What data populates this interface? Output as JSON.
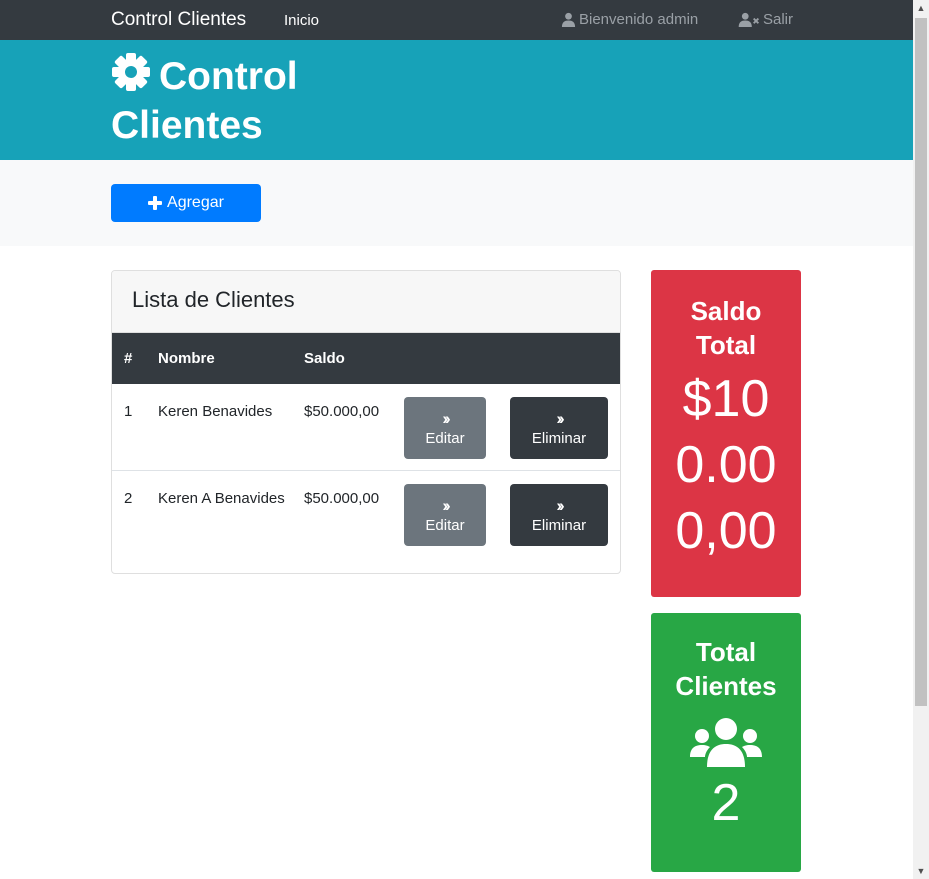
{
  "navbar": {
    "brand": "Control Clientes",
    "inicio": "Inicio",
    "welcome": "Bienvenido admin",
    "logout": "Salir",
    "icons": {
      "welcome": "user-icon",
      "logout": "user-times-icon"
    }
  },
  "header": {
    "title": "Control Clientes",
    "icon": "gear-icon"
  },
  "actions": {
    "add_label": "Agregar",
    "add_icon": "plus-icon"
  },
  "clients_card": {
    "title": "Lista de Clientes",
    "columns": [
      "#",
      "Nombre",
      "Saldo"
    ],
    "rows": [
      {
        "num": "1",
        "name": "Keren Benavides",
        "saldo": "$50.000,00",
        "edit_label": "Editar",
        "delete_label": "Eliminar"
      },
      {
        "num": "2",
        "name": "Keren A Benavides",
        "saldo": "$50.000,00",
        "edit_label": "Editar",
        "delete_label": "Eliminar"
      }
    ]
  },
  "stats": {
    "saldo": {
      "label": "Saldo Total",
      "value": "$100.000,00"
    },
    "clientes": {
      "label": "Total Clientes",
      "value": "2",
      "icon": "users-icon"
    }
  },
  "colors": {
    "navbar": "#343a40",
    "header": "#17a2b8",
    "primary": "#007bff",
    "danger": "#dc3545",
    "success": "#28a745",
    "secondary": "#6c757d"
  }
}
